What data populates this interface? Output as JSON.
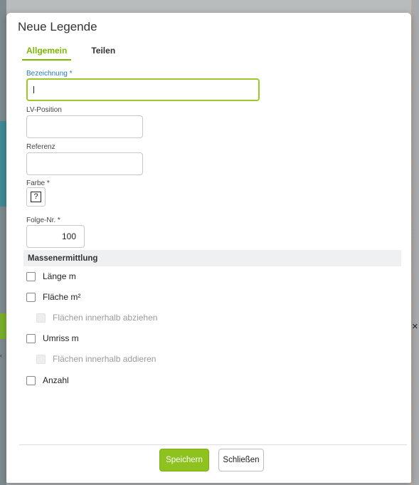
{
  "dialog": {
    "title": "Neue Legende",
    "tabs": [
      {
        "label": "Allgemein",
        "active": true
      },
      {
        "label": "Teilen",
        "active": false
      }
    ]
  },
  "form": {
    "bezeichnung": {
      "label": "Bezeichnung *",
      "value": ""
    },
    "lv_position": {
      "label": "LV-Position",
      "value": ""
    },
    "referenz": {
      "label": "Referenz",
      "value": ""
    },
    "farbe": {
      "label": "Farbe *",
      "swatch_glyph": "?"
    },
    "folge_nr": {
      "label": "Folge-Nr. *",
      "value": "100"
    }
  },
  "massenermittlung": {
    "heading": "Massenermittlung",
    "options": [
      {
        "label": "Länge m",
        "checked": false,
        "disabled": false
      },
      {
        "label": "Fläche m²",
        "checked": false,
        "disabled": false
      },
      {
        "label": "Flächen innerhalb abziehen",
        "checked": false,
        "disabled": true
      },
      {
        "label": "Umriss m",
        "checked": false,
        "disabled": false
      },
      {
        "label": "Flächen innerhalb addieren",
        "checked": false,
        "disabled": true
      },
      {
        "label": "Anzahl",
        "checked": false,
        "disabled": false
      }
    ]
  },
  "footer": {
    "save_label": "Speichern",
    "close_label": "Schließen"
  },
  "colors": {
    "accent": "#8dc21f",
    "label_blue": "#2a7ab8",
    "focus_border": "#9cc929"
  }
}
